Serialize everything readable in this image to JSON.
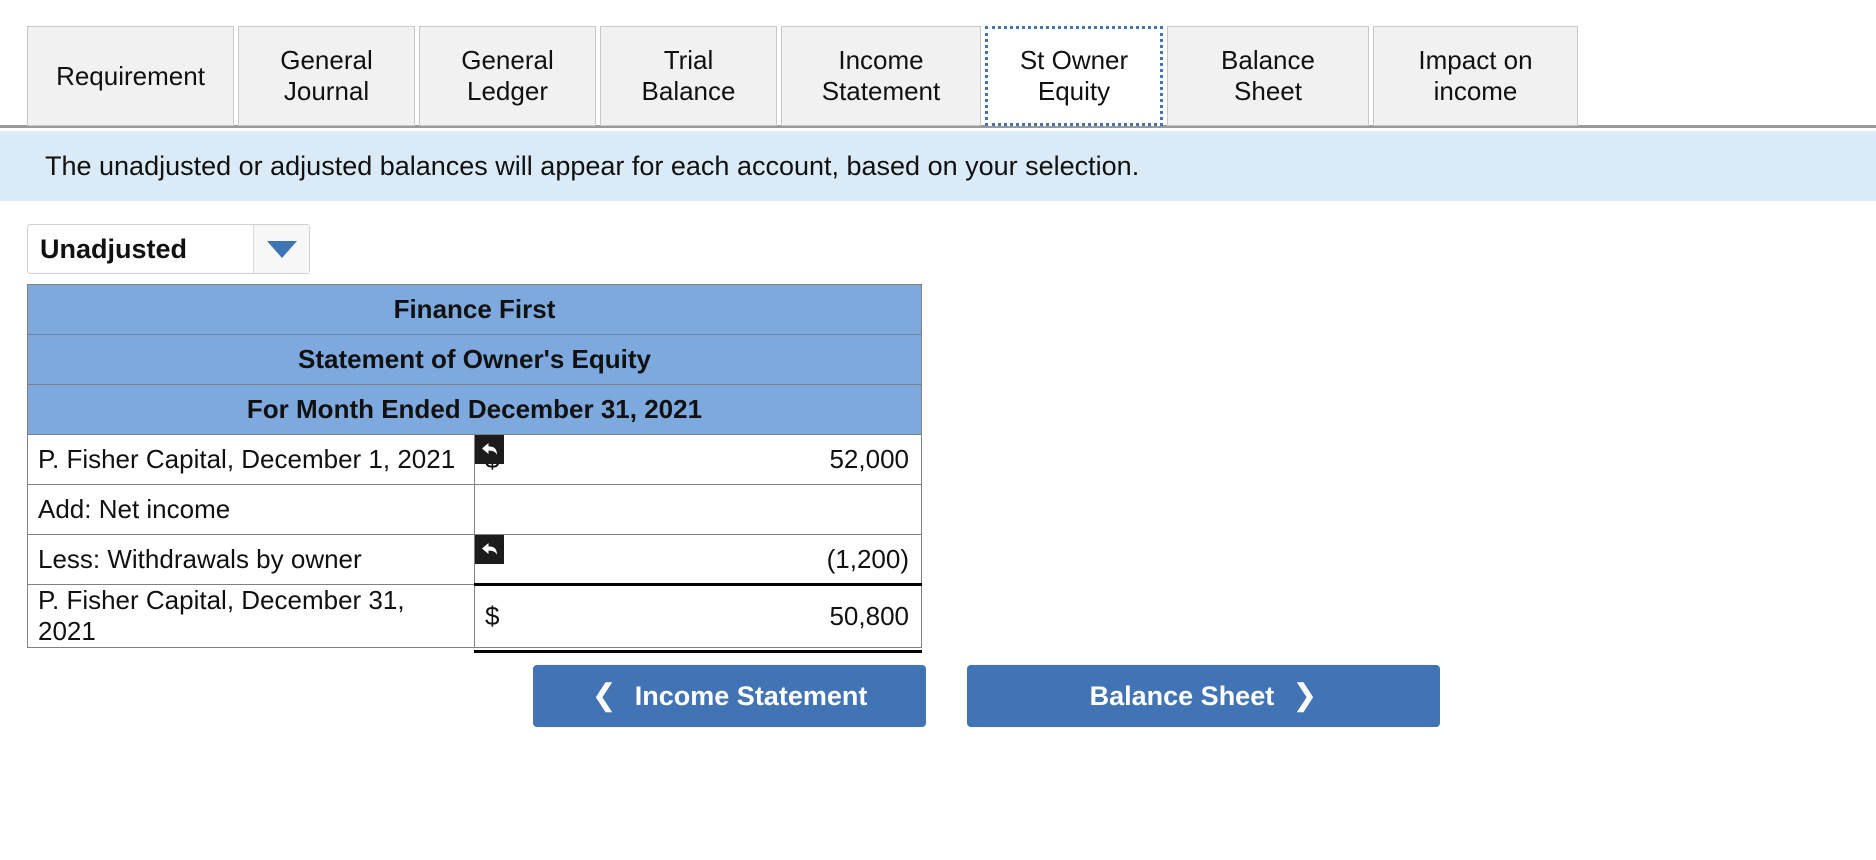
{
  "tabs": [
    {
      "label": "Requirement",
      "selected": false,
      "key": "requirement"
    },
    {
      "label": "General\nJournal",
      "selected": false,
      "key": "general-journal"
    },
    {
      "label": "General\nLedger",
      "selected": false,
      "key": "general-ledger"
    },
    {
      "label": "Trial Balance",
      "selected": false,
      "key": "trial-balance"
    },
    {
      "label": "Income\nStatement",
      "selected": false,
      "key": "income-statement"
    },
    {
      "label": "St Owner\nEquity",
      "selected": true,
      "key": "st-owner-equity"
    },
    {
      "label": "Balance Sheet",
      "selected": false,
      "key": "balance-sheet"
    },
    {
      "label": "Impact on\nincome",
      "selected": false,
      "key": "impact-on-income"
    }
  ],
  "banner": {
    "text": "The unadjusted or adjusted balances will appear for each account, based on your selection."
  },
  "balance_selector": {
    "value": "Unadjusted",
    "icon": "chevron-down-icon"
  },
  "statement": {
    "titles": [
      "Finance First",
      "Statement of Owner's Equity",
      "For Month Ended December 31, 2021"
    ],
    "rows": [
      {
        "label": "P. Fisher Capital, December 1, 2021",
        "currency": "$",
        "value": "52,000",
        "marker": true,
        "total": false
      },
      {
        "label": "Add:  Net income",
        "currency": "",
        "value": "",
        "marker": false,
        "total": false
      },
      {
        "label": "Less:  Withdrawals by owner",
        "currency": "",
        "value": "(1,200)",
        "marker": true,
        "total": false
      },
      {
        "label": "P. Fisher Capital, December 31, 2021",
        "currency": "$",
        "value": "50,800",
        "marker": false,
        "total": true
      }
    ]
  },
  "navigation": {
    "prev_label": "Income Statement",
    "prev_icon": "chevron-left-icon",
    "next_label": "Balance Sheet",
    "next_icon": "chevron-right-icon"
  },
  "colors": {
    "header_blue": "#7ea9de",
    "banner_blue": "#daeaf7",
    "button_blue": "#4274b5",
    "accent_blue": "#3f74b5"
  }
}
